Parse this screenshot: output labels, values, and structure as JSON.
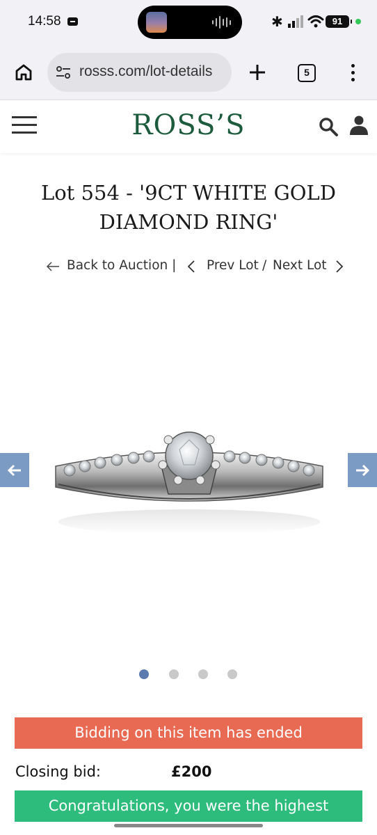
{
  "status_bar": {
    "time": "14:58",
    "battery": "91",
    "icons": [
      "message-icon",
      "bluetooth-icon",
      "signal-icon",
      "wifi-icon",
      "battery-icon"
    ]
  },
  "browser": {
    "url": "rosss.com/lot-details",
    "tab_count": "5",
    "icons": [
      "home-icon",
      "site-settings-icon",
      "new-tab-plus-icon",
      "tabs-icon",
      "more-menu-icon"
    ]
  },
  "site": {
    "logo": "ROSS’S",
    "icons": [
      "hamburger-menu-icon",
      "search-icon",
      "user-account-icon"
    ]
  },
  "lot": {
    "title": "Lot 554 - '9CT WHITE GOLD DIAMOND RING'"
  },
  "lot_nav": {
    "back": "Back to Auction |",
    "prev": "Prev Lot",
    "separator": "/",
    "next": "Next Lot"
  },
  "carousel": {
    "image_count": 4,
    "active_index": 0,
    "colors": {
      "arrow_bg": "#7b9bc4",
      "dot_active": "#5b7bae",
      "dot_inactive": "#c9c9c9"
    }
  },
  "bidding": {
    "ended_message": "Bidding on this item has ended",
    "closing_label": "Closing bid:",
    "closing_value": "£200",
    "congrats_message": "Congratulations, you were the highest",
    "colors": {
      "ended": "#e96a52",
      "congrats": "#2ebc7c",
      "brand": "#1c5c3c"
    }
  }
}
